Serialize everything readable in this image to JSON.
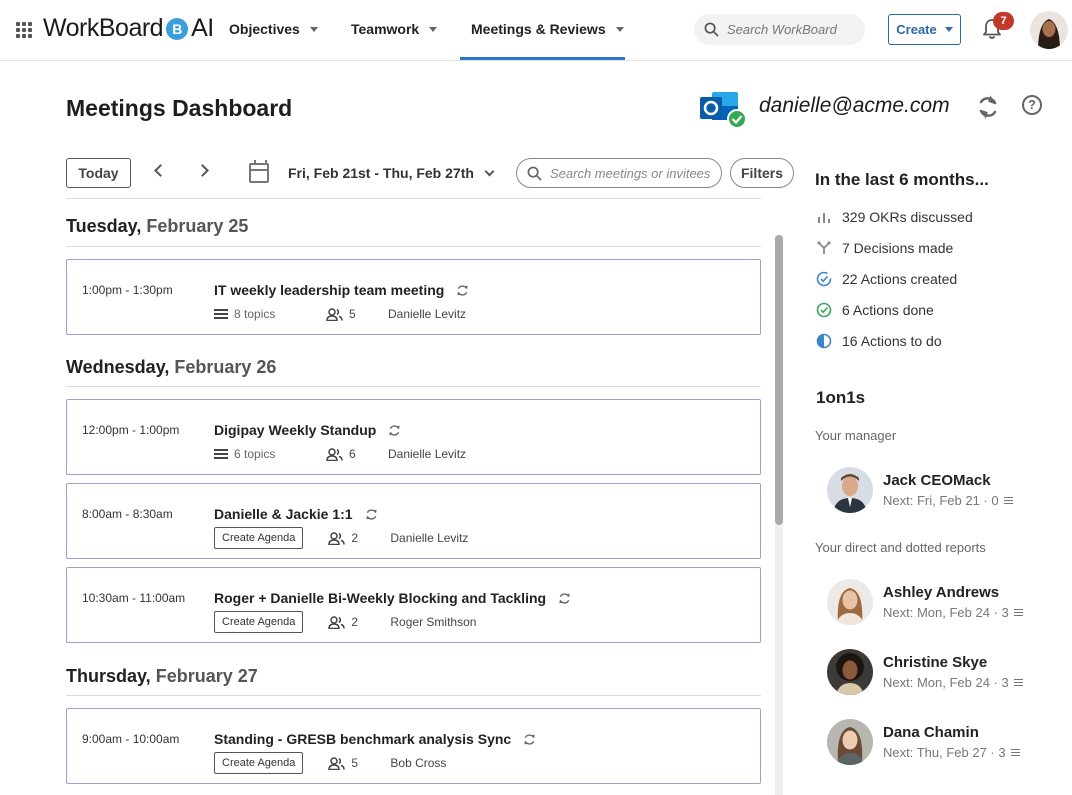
{
  "topnav": {
    "logo_text": "WorkBoard",
    "logo_badge": "B",
    "logo_suffix": "AI",
    "nav_items": [
      "Objectives",
      "Teamwork",
      "Meetings & Reviews"
    ],
    "search_placeholder": "Search WorkBoard",
    "create_label": "Create",
    "notification_count": "7",
    "accent_color": "#2d78c4",
    "badge_color": "#c0392b"
  },
  "header": {
    "title": "Meetings Dashboard",
    "email": "danielle@acme.com",
    "help_glyph": "?"
  },
  "toolbar": {
    "today_label": "Today",
    "date_range": "Fri, Feb 21st - Thu, Feb 27th",
    "search_placeholder": "Search meetings or invitees",
    "filters_label": "Filters"
  },
  "days": [
    {
      "weekday": "Tuesday,",
      "date": "February 25",
      "meetings": [
        {
          "time": "1:00pm - 1:30pm",
          "title": "IT weekly leadership team meeting",
          "topics": "8 topics",
          "attendees": "5",
          "owner": "Danielle Levitz"
        }
      ]
    },
    {
      "weekday": "Wednesday,",
      "date": "February 26",
      "meetings": [
        {
          "time": "12:00pm - 1:00pm",
          "title": "Digipay Weekly Standup",
          "topics": "6 topics",
          "attendees": "6",
          "owner": "Danielle Levitz"
        },
        {
          "time": "8:00am - 8:30am",
          "title": "Danielle & Jackie 1:1",
          "agenda": "Create Agenda",
          "attendees": "2",
          "owner": "Danielle Levitz"
        },
        {
          "time": "10:30am - 11:00am",
          "title": "Roger + Danielle Bi-Weekly Blocking and Tackling",
          "agenda": "Create Agenda",
          "attendees": "2",
          "owner": "Roger Smithson"
        }
      ]
    },
    {
      "weekday": "Thursday,",
      "date": "February 27",
      "meetings": [
        {
          "time": "9:00am - 10:00am",
          "title": "Standing - GRESB benchmark analysis Sync",
          "agenda": "Create Agenda",
          "attendees": "5",
          "owner": "Bob Cross"
        }
      ]
    }
  ],
  "stats": {
    "title": "In the last 6 months...",
    "items": [
      {
        "label": "329 OKRs discussed",
        "icon": "bar-chart-icon"
      },
      {
        "label": "7 Decisions made",
        "icon": "decision-icon"
      },
      {
        "label": "22 Actions created",
        "icon": "action-created-icon"
      },
      {
        "label": "6 Actions done",
        "icon": "action-done-icon"
      },
      {
        "label": "16 Actions to do",
        "icon": "half-circle-icon"
      }
    ]
  },
  "oneonones": {
    "title": "1on1s",
    "manager_label": "Your manager",
    "manager": {
      "name": "Jack CEOMack",
      "next": "Next: Fri, Feb 21 · 0"
    },
    "reports_label": "Your direct and dotted reports",
    "reports": [
      {
        "name": "Ashley Andrews",
        "next": "Next: Mon, Feb 24 · 3"
      },
      {
        "name": "Christine Skye",
        "next": "Next: Mon, Feb 24 · 3"
      },
      {
        "name": "Dana Chamin",
        "next": "Next: Thu, Feb 27 · 3"
      }
    ]
  }
}
